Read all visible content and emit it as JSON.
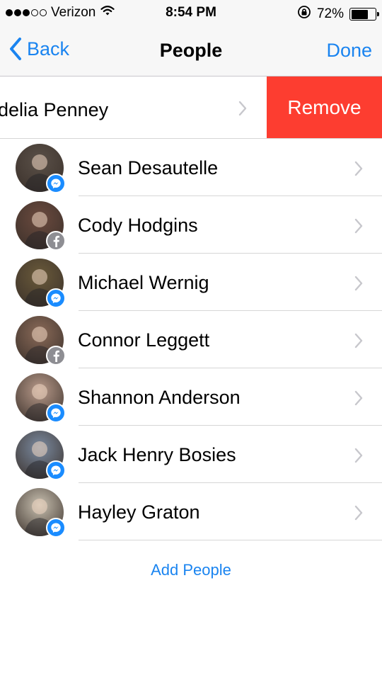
{
  "status_bar": {
    "carrier": "Verizon",
    "time": "8:54 PM",
    "battery_percent": "72%",
    "battery_level": 0.72,
    "signal_bars_filled": 3,
    "signal_bars_total": 5,
    "icons": [
      "wifi-icon",
      "rotation-lock-icon",
      "battery-icon"
    ]
  },
  "nav": {
    "back_label": "Back",
    "title": "People",
    "done_label": "Done"
  },
  "swiped_row": {
    "name": "delia Penney",
    "action_label": "Remove"
  },
  "contacts": [
    {
      "name": "Sean Desautelle",
      "badge": "messenger",
      "avatar_color": "#5a5048"
    },
    {
      "name": "Cody Hodgins",
      "badge": "facebook",
      "avatar_color": "#6b4a3e"
    },
    {
      "name": "Michael Wernig",
      "badge": "messenger",
      "avatar_color": "#6a5a3a"
    },
    {
      "name": "Connor Leggett",
      "badge": "facebook",
      "avatar_color": "#8a6a58"
    },
    {
      "name": "Shannon Anderson",
      "badge": "messenger",
      "avatar_color": "#b89a8a"
    },
    {
      "name": "Jack Henry Bosies",
      "badge": "messenger",
      "avatar_color": "#7a8aa0"
    },
    {
      "name": "Hayley Graton",
      "badge": "messenger",
      "avatar_color": "#c8c0b0"
    }
  ],
  "footer": {
    "add_people_label": "Add People"
  },
  "colors": {
    "accent": "#1a84f0",
    "remove": "#fd3d30",
    "messenger_badge": "#1a8cff",
    "facebook_badge": "#8e8e93"
  }
}
